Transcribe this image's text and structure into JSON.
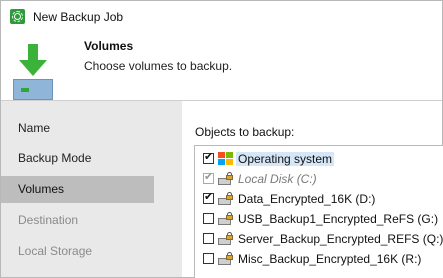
{
  "window": {
    "title": "New Backup Job",
    "app_icon": "veeam-gear-icon"
  },
  "header": {
    "step_title": "Volumes",
    "step_description": "Choose volumes to backup.",
    "icon": "backup-download-arrow-icon",
    "accent_color": "#3bb33a"
  },
  "sidebar": {
    "items": [
      {
        "label": "Name",
        "state": "normal"
      },
      {
        "label": "Backup Mode",
        "state": "normal"
      },
      {
        "label": "Volumes",
        "state": "active"
      },
      {
        "label": "Destination",
        "state": "disabled"
      },
      {
        "label": "Local Storage",
        "state": "disabled"
      }
    ]
  },
  "content": {
    "objects_label": "Objects to backup:",
    "objects": [
      {
        "label": "Operating system",
        "checked": true,
        "disabled": false,
        "icon": "windows-icon",
        "selected": true
      },
      {
        "label": "Local Disk (C:)",
        "checked": true,
        "disabled": true,
        "icon": "locked-disk-icon",
        "selected": false
      },
      {
        "label": "Data_Encrypted_16K (D:)",
        "checked": true,
        "disabled": false,
        "icon": "locked-disk-icon",
        "selected": false
      },
      {
        "label": "USB_Backup1_Encrypted_ReFS (G:)",
        "checked": false,
        "disabled": false,
        "icon": "locked-disk-icon",
        "selected": false
      },
      {
        "label": "Server_Backup_Encrypted_REFS (Q:)",
        "checked": false,
        "disabled": false,
        "icon": "locked-disk-icon",
        "selected": false
      },
      {
        "label": "Misc_Backup_Encrypted_16K (R:)",
        "checked": false,
        "disabled": false,
        "icon": "locked-disk-icon",
        "selected": false
      }
    ]
  }
}
